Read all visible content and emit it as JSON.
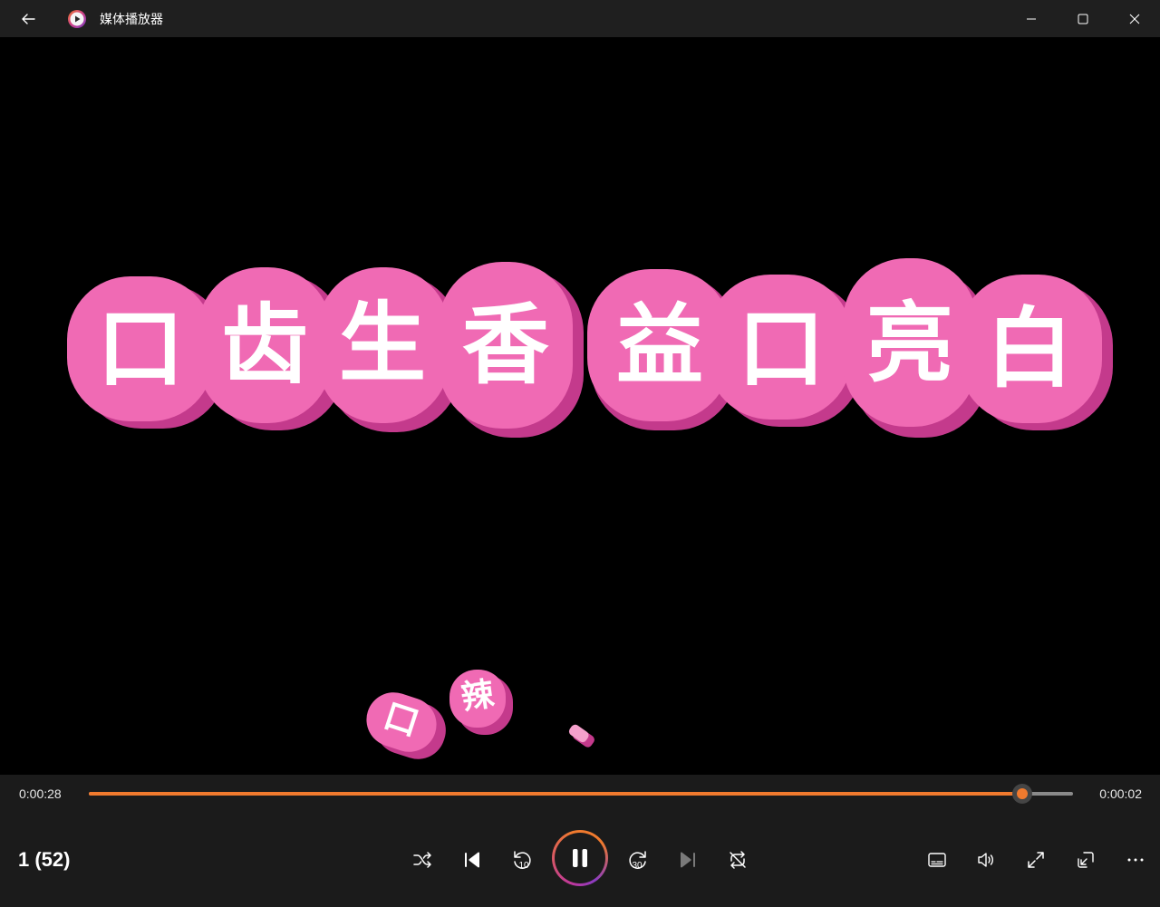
{
  "window": {
    "title": "媒体播放器"
  },
  "video": {
    "title_chars": [
      "口",
      "齿",
      "生",
      "香",
      "益",
      "口",
      "亮",
      "白"
    ],
    "small_chars": [
      "口",
      "辣"
    ],
    "colors": {
      "pink": "#f06ab4",
      "pink_shadow": "#c43a8c",
      "background": "#000000"
    }
  },
  "playback": {
    "elapsed": "0:00:28",
    "remaining": "0:00:02",
    "progress": 0.948,
    "playlist_position": "1 (52)",
    "state": "playing",
    "accent": "#f07a2e"
  },
  "icons": {
    "back": "back-arrow-icon",
    "minimize": "minimize-icon",
    "maximize": "maximize-icon",
    "close": "close-icon",
    "shuffle": "shuffle-icon",
    "previous": "previous-track-icon",
    "skip_back": "skip-back-10-icon",
    "pause": "pause-icon",
    "skip_forward": "skip-forward-30-icon",
    "next": "next-track-icon",
    "repeat": "repeat-icon",
    "subtitles": "subtitles-icon",
    "volume": "volume-icon",
    "fullscreen": "fullscreen-icon",
    "miniplayer": "miniplayer-icon",
    "more": "more-icon"
  },
  "skip_labels": {
    "back": "10",
    "forward": "30"
  }
}
